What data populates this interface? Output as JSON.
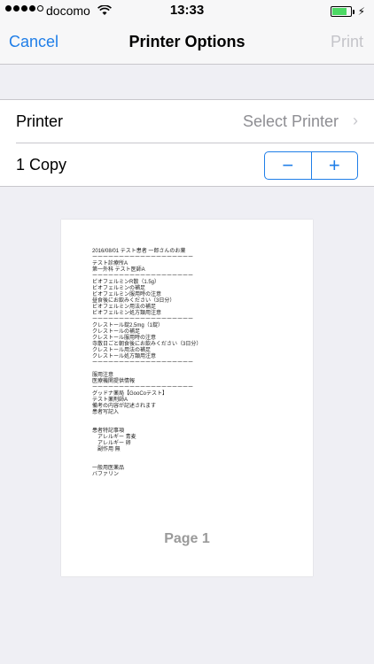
{
  "status_bar": {
    "carrier": "docomo",
    "time": "13:33",
    "battery_fraction": 0.9
  },
  "nav": {
    "cancel": "Cancel",
    "title": "Printer Options",
    "print": "Print"
  },
  "options": {
    "printer_label": "Printer",
    "printer_value": "Select Printer",
    "copies_label": "1 Copy",
    "decrement": "−",
    "increment": "+"
  },
  "preview": {
    "lines": [
      "2016/08/01 テスト患者 一郎さんのお薬",
      "ーーーーーーーーーーーーーーーーーーー",
      "テスト診療所A",
      "第一外科 テスト医師A",
      "ーーーーーーーーーーーーーーーーーーー",
      "ビオフェルミンR散（1.5g）",
      "ビオフェルミンの補足",
      "ビオフェルミン服用時の注意",
      "昼食後にお飲みください（3日分）",
      "ビオフェルミン用法の補足",
      "ビオフェルミン処方類用注意",
      "ーーーーーーーーーーーーーーーーーーー",
      "クレストール錠2.5mg（1錠）",
      "クレストールの補足",
      "クレストール服用時の注意",
      "寺散日ごと朝食後にお飲みください（3日分）",
      "クレストール用法の補足",
      "クレストール処方類用注意",
      "ーーーーーーーーーーーーーーーーーーー",
      "",
      "服用注意",
      "医療機関提供情報",
      "ーーーーーーーーーーーーーーーーーーー",
      "グッドナ薬局【GooCoテスト】",
      "テスト薬剤師A",
      "備考の内容が記述されます",
      "患者写記入",
      "",
      "",
      "患者特記事項",
      "　アレルギー 青麦",
      "　アレルギー 卵",
      "　副作用 無",
      "",
      "",
      "一般用医薬品",
      "バファリン"
    ],
    "page_label": "Page 1"
  }
}
